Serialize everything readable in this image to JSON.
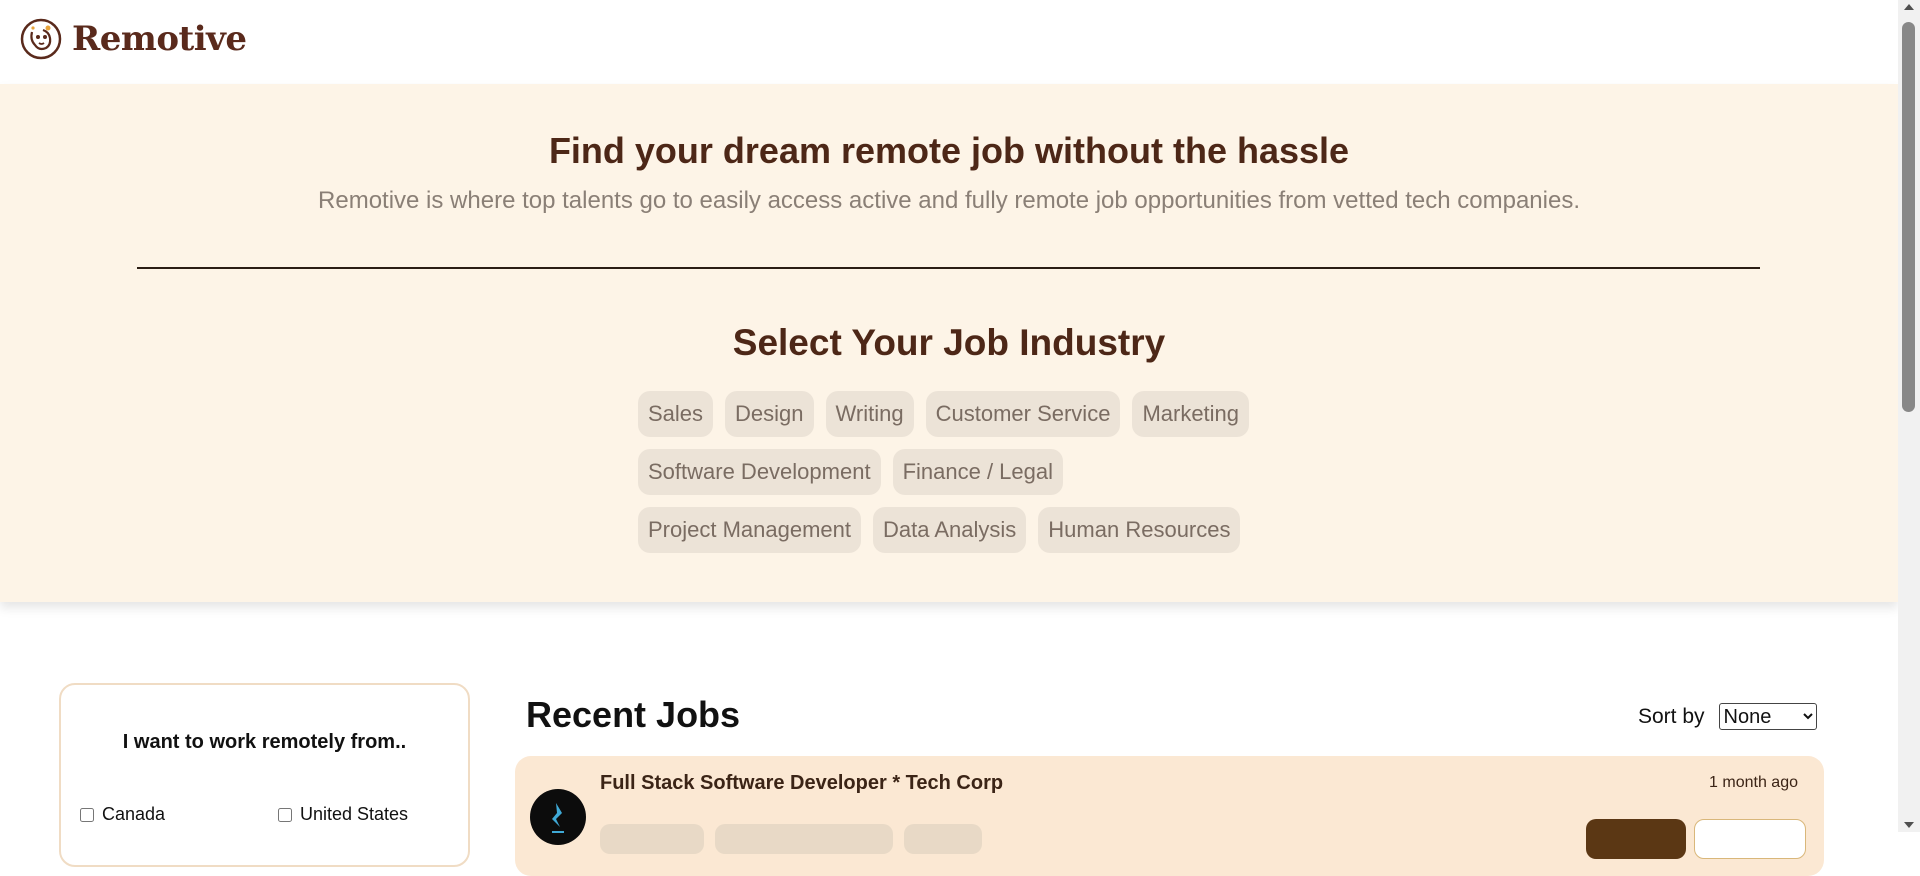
{
  "brand": {
    "name": "Remotive"
  },
  "hero": {
    "title": "Find your dream remote job without the hassle",
    "subtitle": "Remotive is where top talents go to easily access active and fully remote job opportunities from vetted tech companies.",
    "industry_heading": "Select Your Job Industry",
    "industries": [
      [
        "Sales",
        "Design",
        "Writing",
        "Customer Service",
        "Marketing"
      ],
      [
        "Software Development",
        "Finance / Legal"
      ],
      [
        "Project Management",
        "Data Analysis",
        "Human Resources"
      ]
    ]
  },
  "filters": {
    "heading": "I want to work remotely from..",
    "countries": [
      {
        "label": "Canada",
        "checked": false
      },
      {
        "label": "United States",
        "checked": false
      }
    ]
  },
  "jobs": {
    "heading": "Recent Jobs",
    "sort_label": "Sort by",
    "sort_value": "None",
    "items": [
      {
        "title": "Full Stack Software Developer * Tech Corp",
        "posted": "1 month ago"
      }
    ]
  },
  "colors": {
    "brand": "#5a2a1c",
    "hero_bg": "#fdf4e7",
    "chip_bg": "#ece3d7",
    "job_card_bg": "#fbe8d3",
    "apply_button": "#5b3714"
  },
  "icons": {
    "logo": "dog-face-icon",
    "sort": "chevron-down-icon"
  }
}
